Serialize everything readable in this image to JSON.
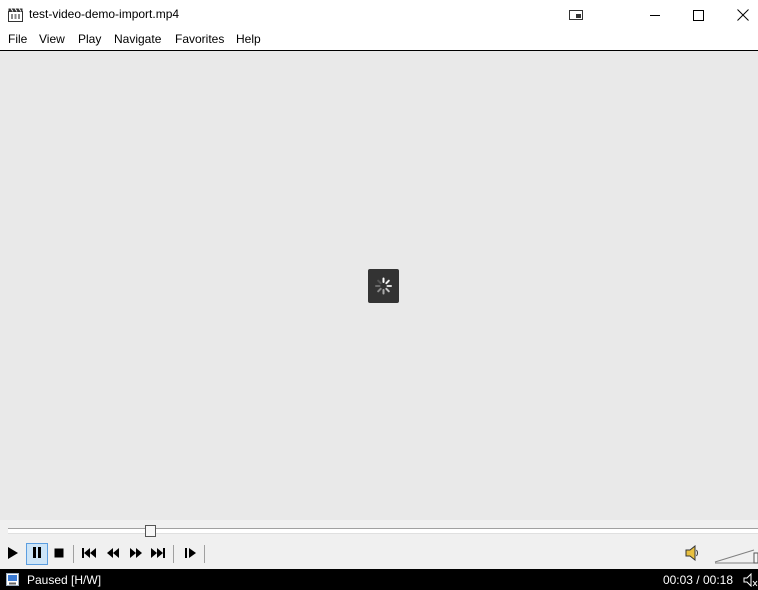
{
  "window": {
    "title": "test-video-demo-import.mp4"
  },
  "menu": {
    "items": [
      {
        "label": "File"
      },
      {
        "label": "View"
      },
      {
        "label": "Play"
      },
      {
        "label": "Navigate"
      },
      {
        "label": "Favorites"
      },
      {
        "label": "Help"
      }
    ]
  },
  "player": {
    "loading": true,
    "seek_fraction": 0.19
  },
  "controls": {
    "icons": [
      "play-icon",
      "pause-icon",
      "stop-icon",
      "previous-icon",
      "rewind-icon",
      "fast-forward-icon",
      "next-icon",
      "frame-step-icon",
      "volume-icon"
    ],
    "active": "pause-icon"
  },
  "status": {
    "state": "Paused [H/W]",
    "time": "00:03 / 00:18"
  },
  "colors": {
    "video_background": "#e9e9e9",
    "status_bar": "#000000",
    "control_bar": "#f0f0f0",
    "active_button": "#cce4f7"
  }
}
